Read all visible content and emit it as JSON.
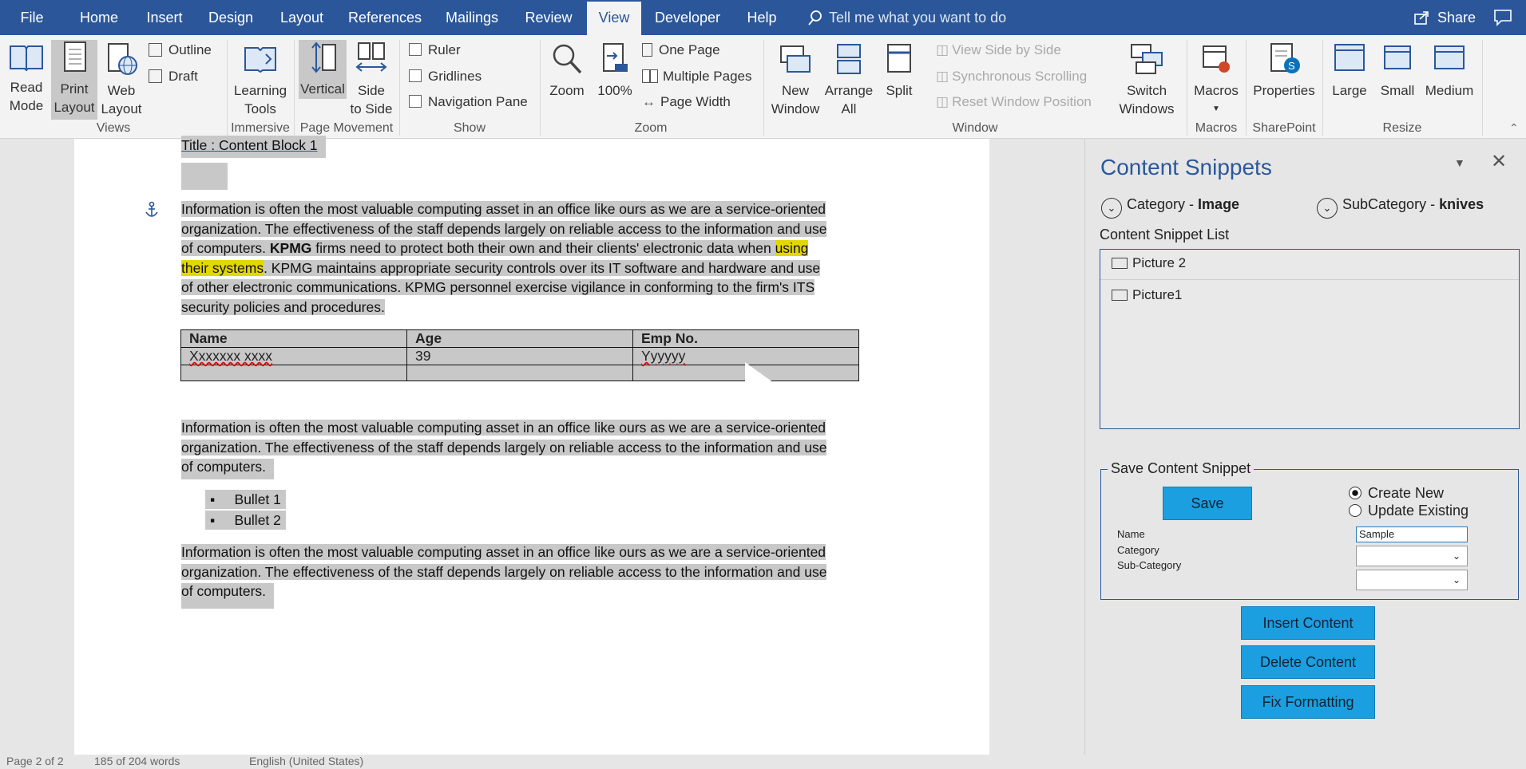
{
  "menu": {
    "tabs": [
      "File",
      "Home",
      "Insert",
      "Design",
      "Layout",
      "References",
      "Mailings",
      "Review",
      "View",
      "Developer",
      "Help"
    ],
    "active": "View",
    "tell_me": "Tell me what you want to do",
    "share": "Share"
  },
  "ribbon": {
    "read_mode": [
      "Read",
      "Mode"
    ],
    "print_layout": [
      "Print",
      "Layout"
    ],
    "web_layout": [
      "Web",
      "Layout"
    ],
    "outline": "Outline",
    "draft": "Draft",
    "views_group": "Views",
    "learning_tools": [
      "Learning",
      "Tools"
    ],
    "immersive_group": "Immersive",
    "vertical": "Vertical",
    "side_to_side": [
      "Side",
      "to Side"
    ],
    "page_movement_group": "Page Movement",
    "ruler": "Ruler",
    "gridlines": "Gridlines",
    "navigation_pane": "Navigation Pane",
    "show_group": "Show",
    "zoom": "Zoom",
    "hundred": "100%",
    "one_page": "One Page",
    "multiple_pages": "Multiple Pages",
    "page_width": "Page Width",
    "zoom_group": "Zoom",
    "new_window": [
      "New",
      "Window"
    ],
    "arrange_all": [
      "Arrange",
      "All"
    ],
    "split": "Split",
    "view_side_by_side": "View Side by Side",
    "sync_scrolling": "Synchronous Scrolling",
    "reset_window": "Reset Window Position",
    "switch_windows": [
      "Switch",
      "Windows"
    ],
    "window_group": "Window",
    "macros": "Macros",
    "macros_group": "Macros",
    "properties": "Properties",
    "sharepoint_group": "SharePoint",
    "large": "Large",
    "small": "Small",
    "medium": "Medium",
    "resize_group": "Resize"
  },
  "document": {
    "title_line": "Title : Content Block 1",
    "para1_a": "Information is often the most valuable computing asset in an office like ours as we are a service-oriented",
    "para1_b": "organization. The effectiveness of the staff depends largely on reliable access to the information and use",
    "para1_c1": "of computers. ",
    "para1_c_bold": "KPMG",
    "para1_c2": " firms need to protect both their own and their clients' electronic data when ",
    "para1_c_hl": "using",
    "para1_d_hl": "their systems",
    "para1_d2": ". KPMG maintains appropriate security controls over its IT software and hardware and use",
    "para1_e": "of other electronic communications. KPMG personnel exercise vigilance in conforming to the firm's ITS",
    "para1_f": "security policies and procedures.",
    "table": {
      "headers": [
        "Name",
        "Age",
        "Emp No."
      ],
      "rows": [
        [
          "Xxxxxxx xxxx",
          "39",
          "Yyyyyy"
        ],
        [
          "",
          "",
          ""
        ]
      ]
    },
    "para2_a": "Information is often the most valuable computing asset in an office like ours as we are a service-oriented",
    "para2_b": "organization. The effectiveness of the staff depends largely on reliable access to the information and use",
    "para2_c": "of computers.",
    "bullets": [
      "Bullet 1",
      "Bullet 2"
    ],
    "para3_a": "Information is often the most valuable computing asset in an office like ours as we are a service-oriented",
    "para3_b": "organization. The effectiveness of the staff depends largely on reliable access to the information and use",
    "para3_c": "of computers."
  },
  "status": {
    "page": "Page 2 of 2",
    "words": "185 of 204 words",
    "lang": "English (United States)"
  },
  "pane": {
    "title": "Content Snippets",
    "category_label": "Category - ",
    "category_value": "Image",
    "subcategory_label": "SubCategory - ",
    "subcategory_value": "knives",
    "list_label": "Content Snippet List",
    "list_items": [
      "Picture 2",
      "Picture1"
    ],
    "save_group": "Save Content Snippet",
    "save_button": "Save",
    "create_new": "Create New",
    "update_existing": "Update Existing",
    "name_label": "Name",
    "category_field_label": "Category",
    "subcategory_field_label": "Sub-Category",
    "name_value": "Sample",
    "insert_button": "Insert Content",
    "delete_button": "Delete Content",
    "fix_button": "Fix Formatting"
  },
  "colors": {
    "accent": "#2b579a",
    "pane_title": "#2b579a",
    "button": "#1b9fe0",
    "highlight": "#e3d700",
    "selection": "#c8c8c8"
  }
}
